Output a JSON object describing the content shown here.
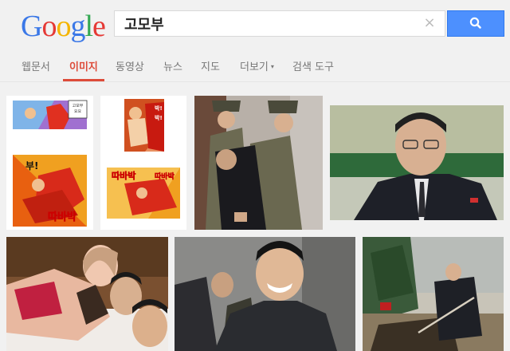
{
  "logo": {
    "letters": [
      "G",
      "o",
      "o",
      "g",
      "l",
      "e"
    ],
    "colors": [
      "#3b78e7",
      "#e53935",
      "#f4b400",
      "#3b78e7",
      "#34a853",
      "#e53935"
    ]
  },
  "search": {
    "query": "고모부",
    "clear_label": "×"
  },
  "tabs": [
    {
      "label": "웹문서",
      "active": false
    },
    {
      "label": "이미지",
      "active": true
    },
    {
      "label": "동영상",
      "active": false
    },
    {
      "label": "뉴스",
      "active": false
    },
    {
      "label": "지도",
      "active": false
    },
    {
      "label": "더보기",
      "active": false,
      "caret": "▾"
    },
    {
      "label": "검색 도구",
      "active": false
    }
  ],
  "results": {
    "comic_captions": {
      "bubble1": "고모부\n요요",
      "bubble2": "부!",
      "bubble3": "따바박",
      "bubble4": "따바박",
      "bubble5": "따바박",
      "bubble6": "박!\n박!"
    }
  },
  "colors": {
    "accent": "#dd4b39",
    "search_button": "#4d90fe"
  }
}
